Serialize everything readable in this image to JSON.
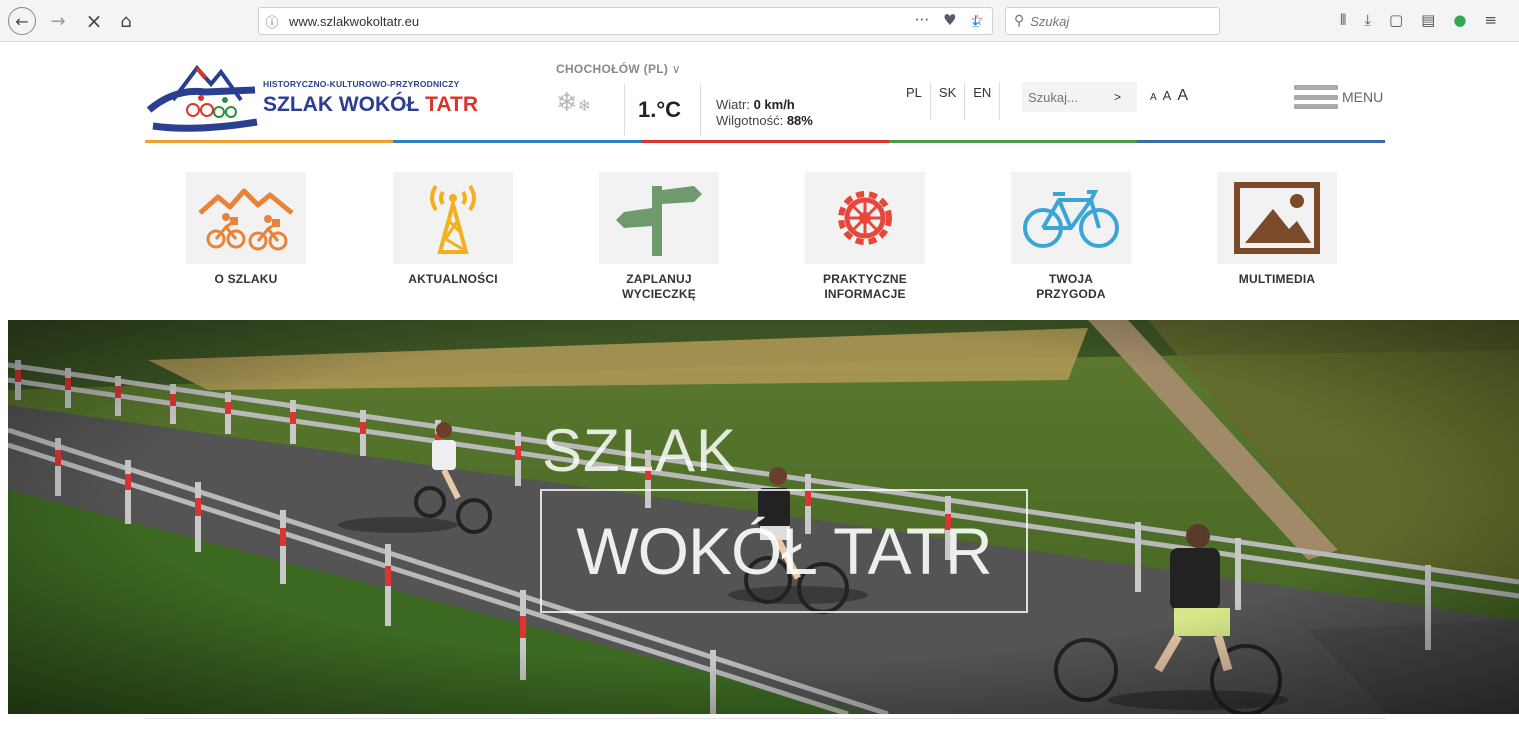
{
  "browser": {
    "url": "www.szlakwokoltatr.eu",
    "search_placeholder": "Szukaj"
  },
  "site": {
    "logo_subtitle": "HISTORYCZNO-KULTUROWO-PRZYRODNICZY",
    "logo_title_a": "SZLAK WOKÓŁ ",
    "logo_title_b": "TATR",
    "location": "CHOCHOŁÓW (PL)",
    "temperature": "1.°C",
    "wind_label": "Wiatr: ",
    "wind_value": "0 km/h",
    "humidity_label": "Wilgotność: ",
    "humidity_value": "88%",
    "languages": [
      "PL",
      "SK",
      "EN"
    ],
    "search_placeholder": "Szukaj...",
    "search_go": ">",
    "font_sizes": [
      "A",
      "A",
      "A"
    ],
    "menu_label": "MENU",
    "line_colors": [
      "#f0a030",
      "#2c7fc0",
      "#d9362b",
      "#4a9a4a",
      "#3b6ea8"
    ]
  },
  "categories": [
    {
      "line1": "O SZLAKU",
      "line2": ""
    },
    {
      "line1": "AKTUALNOŚCI",
      "line2": ""
    },
    {
      "line1": "ZAPLANUJ",
      "line2": "WYCIECZKĘ"
    },
    {
      "line1": "PRAKTYCZNE",
      "line2": "INFORMACJE"
    },
    {
      "line1": "TWOJA",
      "line2": "PRZYGODA"
    },
    {
      "line1": "MULTIMEDIA",
      "line2": ""
    }
  ],
  "hero": {
    "title_top": "SZLAK",
    "title_bottom": "WOKÓŁ TATR"
  }
}
